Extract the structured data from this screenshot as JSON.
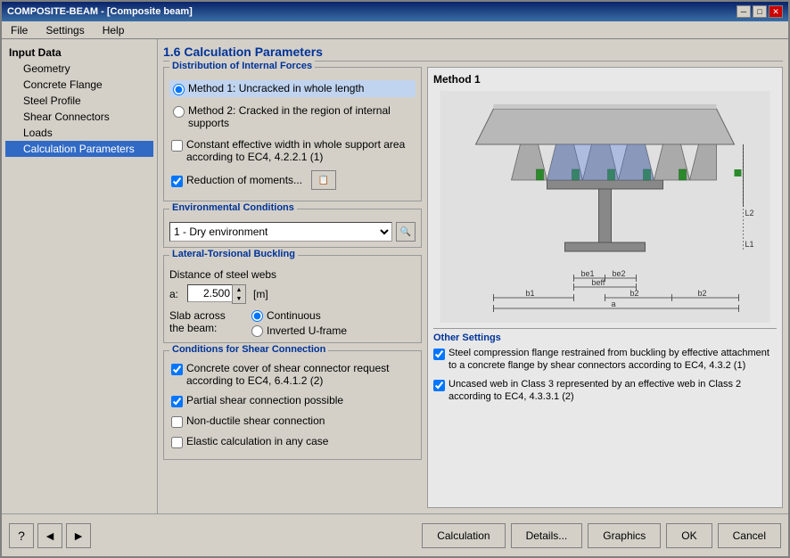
{
  "window": {
    "title": "COMPOSITE-BEAM - [Composite beam]",
    "close_label": "✕",
    "min_label": "─",
    "max_label": "□"
  },
  "menu": {
    "items": [
      "File",
      "Settings",
      "Help"
    ]
  },
  "sidebar": {
    "group": "Input Data",
    "items": [
      {
        "label": "Geometry",
        "active": false
      },
      {
        "label": "Concrete Flange",
        "active": false
      },
      {
        "label": "Steel Profile",
        "active": false
      },
      {
        "label": "Shear Connectors",
        "active": false
      },
      {
        "label": "Loads",
        "active": false
      },
      {
        "label": "Calculation Parameters",
        "active": true
      }
    ]
  },
  "main": {
    "section_title": "1.6 Calculation Parameters",
    "distribution_title": "Distribution of Internal Forces",
    "method1_label": "Method 1: Uncracked in whole length",
    "method2_label": "Method 2: Cracked in the region of internal supports",
    "checkbox1_label": "Constant effective width in whole support area according to EC4, 4.2.2.1 (1)",
    "checkbox2_label": "Reduction of moments...",
    "env_title": "Environmental Conditions",
    "env_value": "1  - Dry environment",
    "lateral_title": "Lateral-Torsional Buckling",
    "distance_label": "Distance of steel webs",
    "distance_a_label": "a:",
    "distance_value": "2.500",
    "unit_label": "[m]",
    "slab_label": "Slab across the beam:",
    "slab_option1": "Continuous",
    "slab_option2": "Inverted U-frame",
    "shear_title": "Conditions for Shear Connection",
    "shear_cb1": "Concrete cover of shear connector request according to EC4, 6.4.1.2 (2)",
    "shear_cb2": "Partial shear connection possible",
    "shear_cb3": "Non-ductile shear connection",
    "shear_cb4": "Elastic calculation in any case",
    "diagram_method": "Method 1",
    "other_title": "Other Settings",
    "other_cb1": "Steel compression flange restrained from buckling by effective attachment to a concrete flange by shear connectors according to EC4, 4.3.2 (1)",
    "other_cb2": "Uncased web in Class 3 represented by an effective web in Class 2 according to EC4, 4.3.3.1 (2)"
  },
  "footer": {
    "calculation_label": "Calculation",
    "details_label": "Details...",
    "graphics_label": "Graphics",
    "ok_label": "OK",
    "cancel_label": "Cancel"
  },
  "icons": {
    "help": "?",
    "back": "←",
    "forward": "→",
    "search": "🔍",
    "info": "📋",
    "spin_up": "▲",
    "spin_down": "▼"
  }
}
